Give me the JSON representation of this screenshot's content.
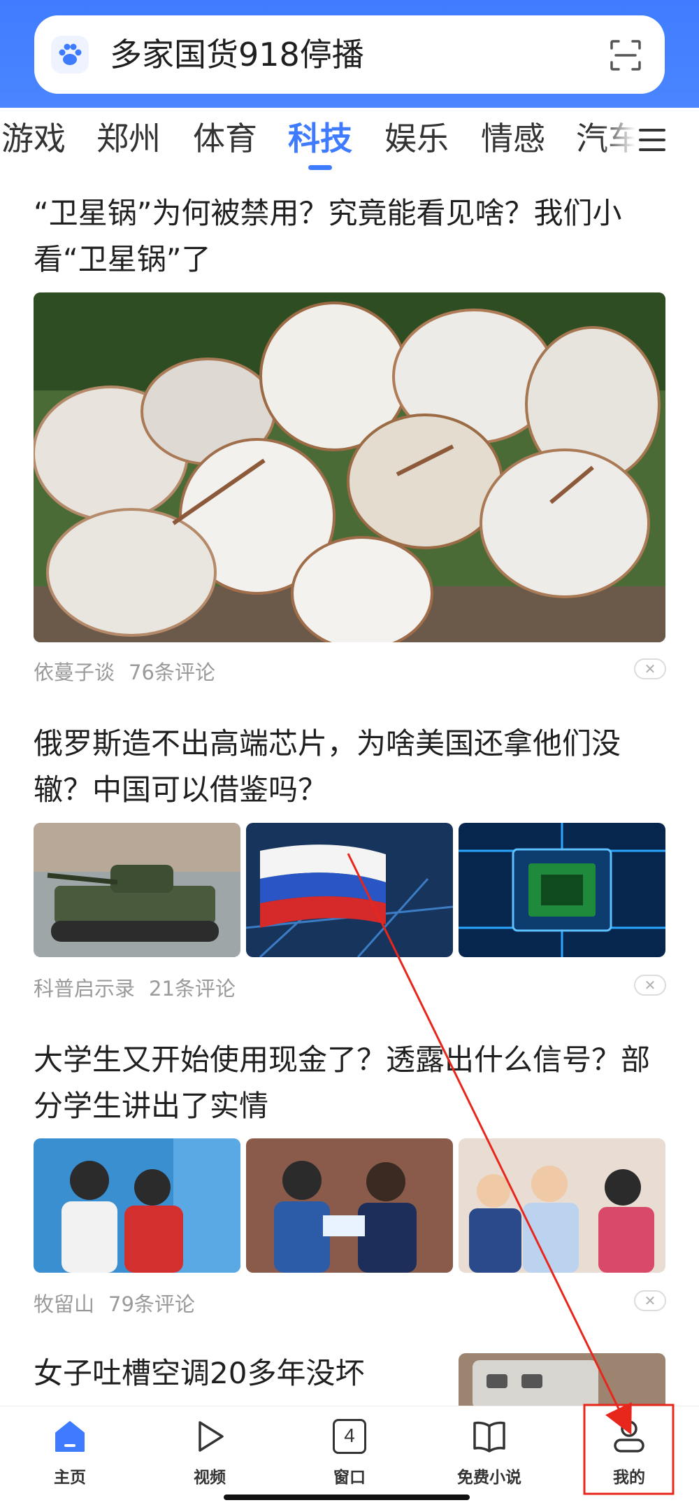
{
  "search": {
    "query": "多家国货918停播",
    "icon": "paw-icon",
    "scan_icon": "scan-icon"
  },
  "tabs": [
    {
      "label": "游戏"
    },
    {
      "label": "郑州"
    },
    {
      "label": "体育"
    },
    {
      "label": "科技",
      "active": true
    },
    {
      "label": "娱乐"
    },
    {
      "label": "情感"
    },
    {
      "label": "汽车"
    }
  ],
  "articles": [
    {
      "title": "“卫星锅”为何被禁用？究竟能看见啥？我们小看“卫星锅”了",
      "source": "依蔓子谈",
      "comments": "76条评论"
    },
    {
      "title": "俄罗斯造不出高端芯片，为啥美国还拿他们没辙？中国可以借鉴吗？",
      "source": "科普启示录",
      "comments": "21条评论"
    },
    {
      "title": "大学生又开始使用现金了？透露出什么信号？部分学生讲出了实情",
      "source": "牧留山",
      "comments": "79条评论"
    },
    {
      "title": "女子吐槽空调20多年没坏"
    }
  ],
  "bottom_nav": [
    {
      "label": "主页",
      "icon": "home-icon",
      "active": true
    },
    {
      "label": "视频",
      "icon": "play-icon"
    },
    {
      "label": "窗口",
      "icon": "window-count-icon",
      "count": "4"
    },
    {
      "label": "免费小说",
      "icon": "book-icon"
    },
    {
      "label": "我的",
      "icon": "profile-icon"
    }
  ],
  "colors": {
    "brand_blue": "#3e7bff",
    "annotation_red": "#e8271c"
  }
}
